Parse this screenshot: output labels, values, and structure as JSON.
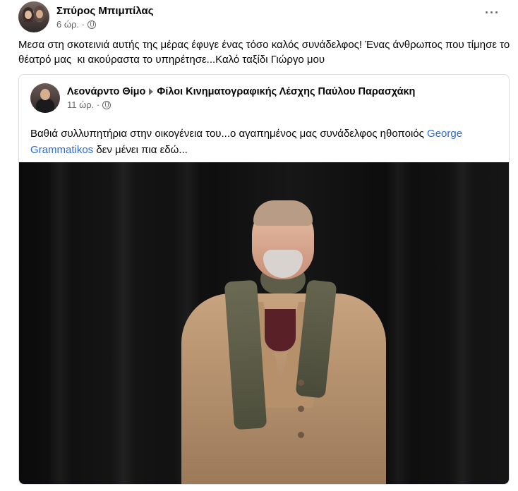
{
  "post": {
    "author": "Σπύρος Μπιμπίλας",
    "time": "6 ώρ. ·",
    "text": "Μεσα στη σκοτεινιά αυτής της μέρας έφυγε ένας τόσο καλός συνάδελφος! Ένας άνθρωπος που τίμησε το θέατρό μας  κι ακούραστα το υπηρέτησε...Καλό ταξίδι Γιώργο μου",
    "more_label": "···"
  },
  "shared": {
    "author": "Λεονάρντο Θίμο",
    "group": "Φίλοι Κινηματογραφικής Λέσχης Παύλου Παρασχάκη",
    "time": "11 ώρ. ·",
    "text_part1": "Βαθιά συλλυπητήρια στην οικογένεια του...ο αγαπημένος μας συνάδελφος ηθοποιός ",
    "link": "George Grammatikos",
    "text_part2": " δεν μένει πια εδώ..."
  },
  "colors": {
    "link": "#2d6ad6",
    "secondary_text": "#65676b",
    "border": "#dadde1"
  },
  "icons": {
    "privacy": "globe-icon",
    "group_arrow": "triangle-right-icon",
    "more": "more-horizontal-icon"
  }
}
